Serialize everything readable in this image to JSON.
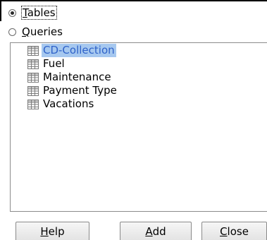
{
  "radios": {
    "tables": {
      "label_ul": "T",
      "label_rest": "ables",
      "checked": true
    },
    "queries": {
      "label_ul": "Q",
      "label_rest": "ueries",
      "checked": false
    }
  },
  "list": {
    "items": [
      {
        "label": "CD-Collection",
        "selected": true,
        "icon": "table-icon"
      },
      {
        "label": "Fuel",
        "selected": false,
        "icon": "table-icon"
      },
      {
        "label": "Maintenance",
        "selected": false,
        "icon": "table-icon"
      },
      {
        "label": "Payment Type",
        "selected": false,
        "icon": "table-icon"
      },
      {
        "label": "Vacations",
        "selected": false,
        "icon": "table-icon"
      }
    ]
  },
  "buttons": {
    "help": {
      "ul": "H",
      "rest": "elp"
    },
    "add": {
      "ul": "A",
      "rest": "dd"
    },
    "close": {
      "ul": "C",
      "rest": "lose"
    }
  },
  "colors": {
    "selection_bg": "#a6c8ef",
    "selection_text": "#2f62c9"
  }
}
